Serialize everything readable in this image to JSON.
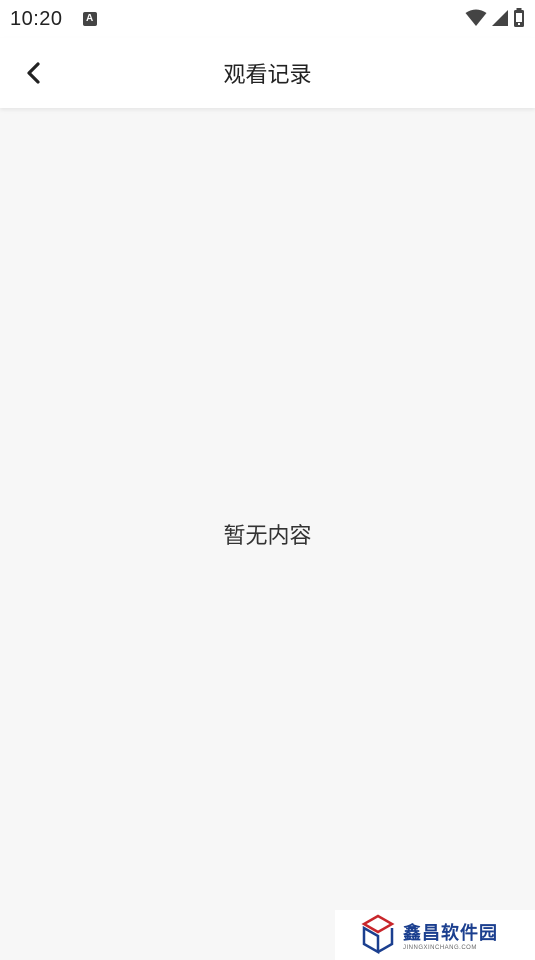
{
  "status_bar": {
    "time": "10:20",
    "notification_icon": "a-icon",
    "icons": [
      "wifi-icon",
      "signal-icon",
      "battery-icon"
    ]
  },
  "header": {
    "title": "观看记录",
    "back_icon": "chevron-left-icon"
  },
  "content": {
    "empty_message": "暂无内容"
  },
  "watermark": {
    "brand": "鑫昌软件园",
    "subtitle": "JINNGXINCHANG.COM"
  },
  "colors": {
    "background": "#f7f7f7",
    "header_bg": "#ffffff",
    "text": "#222222",
    "watermark_blue": "#1b3f8f",
    "watermark_red": "#c8262b"
  }
}
